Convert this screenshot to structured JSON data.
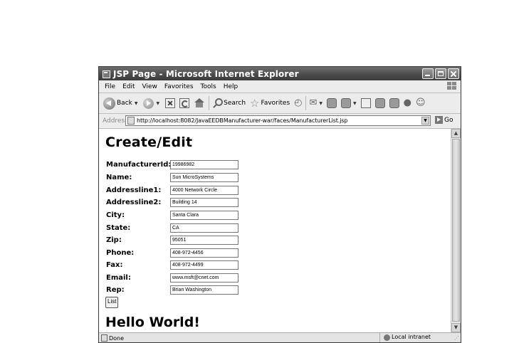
{
  "window": {
    "title": "JSP Page - Microsoft Internet Explorer"
  },
  "menu": [
    "File",
    "Edit",
    "View",
    "Favorites",
    "Tools",
    "Help"
  ],
  "toolbar": {
    "back_label": "Back",
    "search_label": "Search",
    "favorites_label": "Favorites"
  },
  "address": {
    "label": "Address",
    "url": "http://localhost:8082/JavaEEDBManufacturer-war/faces/ManufacturerList.jsp",
    "go_label": "Go"
  },
  "page": {
    "heading": "Create/Edit",
    "fields": [
      {
        "label": "ManufacturerId:",
        "value": "19986982"
      },
      {
        "label": "Name:",
        "value": "Sun MicroSystems"
      },
      {
        "label": "Addressline1:",
        "value": "4000 Network Circle"
      },
      {
        "label": "Addressline2:",
        "value": "Building 14"
      },
      {
        "label": "City:",
        "value": "Santa Clara"
      },
      {
        "label": "State:",
        "value": "CA"
      },
      {
        "label": "Zip:",
        "value": "95051"
      },
      {
        "label": "Phone:",
        "value": "408-972-4456"
      },
      {
        "label": "Fax:",
        "value": "408-972-4499"
      },
      {
        "label": "Email:",
        "value": "www.msft@cnet.com"
      },
      {
        "label": "Rep:",
        "value": "Brian Washington"
      }
    ],
    "list_button": "List",
    "footer_heading": "Hello World!"
  },
  "status": {
    "text": "Done",
    "zone": "Local intranet"
  }
}
